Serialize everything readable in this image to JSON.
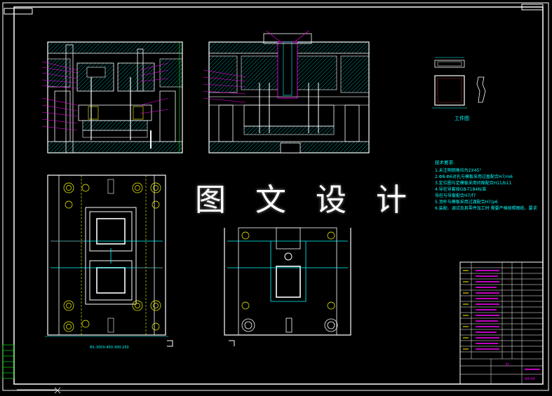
{
  "watermark": "图 文 设 计",
  "workpiece_label": "工件图",
  "technical_requirements": {
    "title": "技术要求:",
    "items": [
      "1.未注明倒角均为2X45°",
      "2.Φ8-Φ6对孔与模板采用过盈配合H7/m6",
      "3.定位圈与定模板采用间隙配合H11/b11",
      "4.导柱导套按GB-T184标准",
      "  导柱与导套配合H7/f7",
      "5.顶杆与模板采用过渡配合H7/p6",
      "6.装配、调试及其零件加工时 需要严格按照图纸、要求"
    ]
  },
  "dimension_bottom": "Φ1-300X-450-300-250",
  "title_block_code": "SA-00",
  "title_block_number": "31",
  "colors": {
    "background": "#000000",
    "frame": "#ffffff",
    "dimension": "#00ffff",
    "annotation": "#ff00ff",
    "hatch": "#00ffff",
    "part_outline": "#ffffff",
    "red": "#ff3333",
    "yellow": "#ffff00",
    "green": "#00ff00"
  }
}
